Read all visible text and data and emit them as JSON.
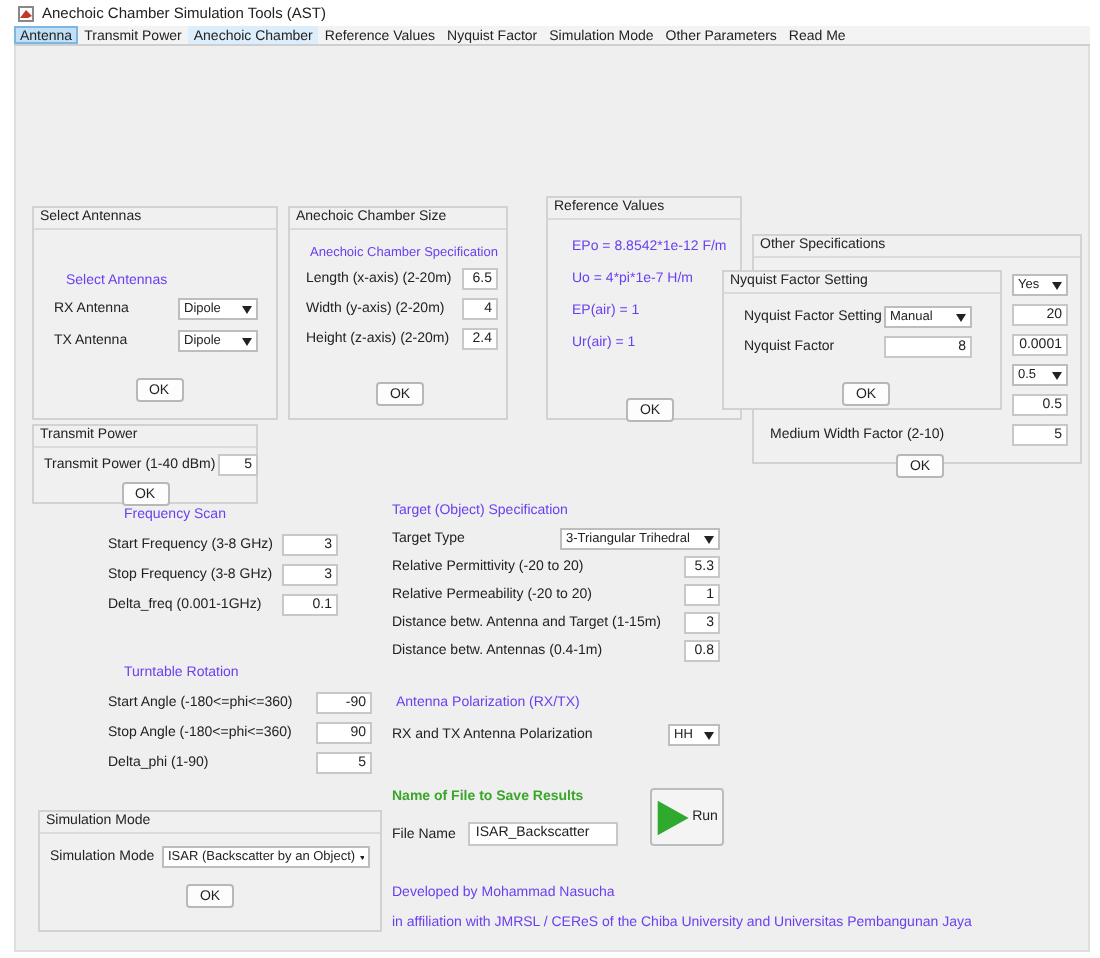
{
  "window": {
    "title": "Anechoic Chamber Simulation Tools (AST)"
  },
  "tabs": [
    {
      "label": "Antenna",
      "selected": true,
      "highlighted": true
    },
    {
      "label": "Transmit Power",
      "selected": false,
      "highlighted": false
    },
    {
      "label": "Anechoic Chamber",
      "selected": false,
      "highlighted": true
    },
    {
      "label": "Reference Values",
      "selected": false,
      "highlighted": false
    },
    {
      "label": "Nyquist Factor",
      "selected": false,
      "highlighted": false
    },
    {
      "label": "Simulation Mode",
      "selected": false,
      "highlighted": false
    },
    {
      "label": "Other Parameters",
      "selected": false,
      "highlighted": false
    },
    {
      "label": "Read Me",
      "selected": false,
      "highlighted": false
    }
  ],
  "select_antennas": {
    "title": "Select Antennas",
    "heading": "Select Antennas",
    "rows": [
      {
        "kind": "dropdown",
        "label": "RX Antenna",
        "value": "Dipole"
      },
      {
        "kind": "dropdown",
        "label": "TX Antenna",
        "value": "Dipole"
      }
    ],
    "button": "OK"
  },
  "chamber_size": {
    "title": "Anechoic Chamber Size",
    "heading": "Anechoic Chamber Specification",
    "rows": [
      {
        "kind": "field",
        "label": "Length (x-axis) (2-20m)",
        "value": "6.5"
      },
      {
        "kind": "field",
        "label": "Width (y-axis) (2-20m)",
        "value": "4"
      },
      {
        "kind": "field",
        "label": "Height (z-axis) (2-20m)",
        "value": "2.4"
      }
    ],
    "button": "OK"
  },
  "reference_values": {
    "title": "Reference Values",
    "lines": [
      "EPo = 8.8542*1e-12 F/m",
      "Uo = 4*pi*1e-7 H/m",
      "EP(air) = 1",
      "Ur(air) = 1"
    ],
    "button": "OK"
  },
  "other_specifications": {
    "title": "Other Specifications",
    "rows": [
      {
        "kind": "dropdown",
        "value": "Yes"
      },
      {
        "kind": "field",
        "value": "20"
      },
      {
        "kind": "field",
        "value": "0.0001"
      },
      {
        "kind": "dropdown",
        "value": "0.5"
      },
      {
        "kind": "field",
        "value": "0.5"
      },
      {
        "kind": "field",
        "label": "Medium Width Factor (2-10)",
        "value": "5"
      }
    ],
    "button": "OK"
  },
  "nyquist_factor": {
    "title": "Nyquist Factor Setting",
    "rows": [
      {
        "kind": "dropdown",
        "label": "Nyquist Factor Setting",
        "value": "Manual"
      },
      {
        "kind": "field",
        "label": "Nyquist Factor",
        "value": "8"
      }
    ],
    "button": "OK"
  },
  "transmit_power": {
    "title": "Transmit Power",
    "rows": [
      {
        "kind": "field",
        "label": "Transmit Power (1-40 dBm)",
        "value": "5"
      }
    ],
    "button": "OK"
  },
  "frequency_scan": {
    "heading": "Frequency Scan",
    "rows": [
      {
        "kind": "field",
        "label": "Start Frequency (3-8 GHz)",
        "value": "3"
      },
      {
        "kind": "field",
        "label": "Stop Frequency (3-8 GHz)",
        "value": "3"
      },
      {
        "kind": "field",
        "label": "Delta_freq (0.001-1GHz)",
        "value": "0.1"
      }
    ]
  },
  "turntable_rotation": {
    "heading": "Turntable Rotation",
    "rows": [
      {
        "kind": "field",
        "label": "Start Angle (-180<=phi<=360)",
        "value": "-90"
      },
      {
        "kind": "field",
        "label": "Stop Angle (-180<=phi<=360)",
        "value": "90"
      },
      {
        "kind": "field",
        "label": "Delta_phi (1-90)",
        "value": "5"
      }
    ]
  },
  "simulation_mode": {
    "title": "Simulation Mode",
    "rows": [
      {
        "kind": "dropdown",
        "label": "Simulation Mode",
        "value": "ISAR (Backscatter by an Object)"
      }
    ],
    "button": "OK"
  },
  "target_specification": {
    "heading": "Target (Object) Specification",
    "rows": [
      {
        "kind": "dropdown",
        "label": "Target Type",
        "value": "3-Triangular Trihedral"
      },
      {
        "kind": "field",
        "label": "Relative Permittivity (-20 to 20)",
        "value": "5.3"
      },
      {
        "kind": "field",
        "label": "Relative Permeability (-20 to 20)",
        "value": "1"
      },
      {
        "kind": "field",
        "label": "Distance betw. Antenna and Target (1-15m)",
        "value": "3"
      },
      {
        "kind": "field",
        "label": "Distance betw. Antennas (0.4-1m)",
        "value": "0.8"
      }
    ]
  },
  "antenna_polarization": {
    "heading": "Antenna Polarization (RX/TX)",
    "rows": [
      {
        "kind": "dropdown",
        "label": "RX and TX Antenna Polarization",
        "value": "HH"
      }
    ]
  },
  "save_results": {
    "heading": "Name of File to Save Results",
    "file_name": {
      "label": "File Name",
      "value": "ISAR_Backscatter"
    },
    "run_button": "Run"
  },
  "credits": [
    "Developed by Mohammad Nasucha",
    "in affiliation with JMRSL / CEReS of the Chiba University and Universitas Pembangunan Jaya"
  ]
}
